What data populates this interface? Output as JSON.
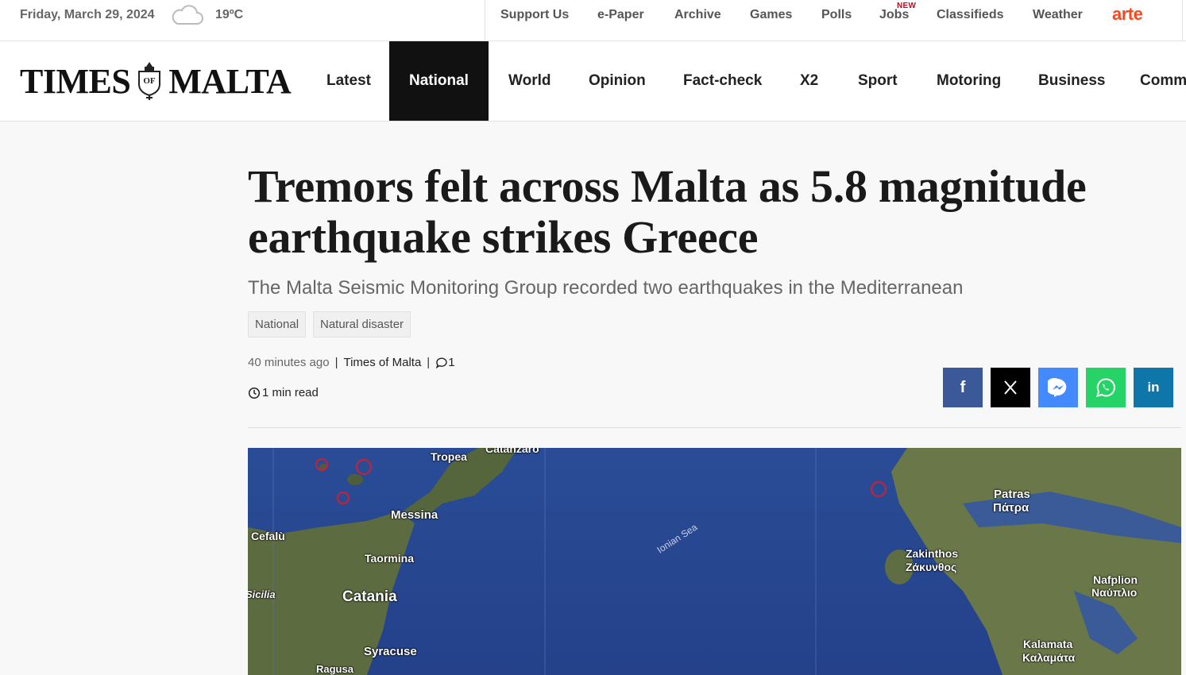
{
  "topbar": {
    "date": "Friday, March 29, 2024",
    "temperature": "19ºC",
    "weather_icon": "cloud-icon",
    "links": [
      "Support Us",
      "e-Paper",
      "Archive",
      "Games",
      "Polls",
      "Jobs",
      "Classifieds",
      "Weather"
    ],
    "jobs_badge": "NEW",
    "partner_logo": "arte"
  },
  "header": {
    "logo_left": "TIMES",
    "logo_crest_text": "OF",
    "logo_right": "MALTA",
    "nav": [
      "Latest",
      "National",
      "World",
      "Opinion",
      "Fact-check",
      "X2",
      "Sport",
      "Motoring",
      "Business",
      "Comm"
    ],
    "active_nav": "National"
  },
  "article": {
    "title_line1": "Tremors felt across Malta as 5.8 magnitude",
    "title_line2": "earthquake strikes Greece",
    "subtitle": "The Malta Seismic Monitoring Group recorded two earthquakes in the Mediterranean",
    "tags": [
      "National",
      "Natural disaster"
    ],
    "published": "40 minutes ago",
    "author": "Times of Malta",
    "comment_count": "1",
    "read_time": "1 min read"
  },
  "share": {
    "buttons": [
      {
        "name": "facebook",
        "icon": "facebook-icon",
        "color": "#3b5998",
        "label": "f"
      },
      {
        "name": "x",
        "icon": "x-icon",
        "color": "#000000",
        "label": "𝕏"
      },
      {
        "name": "messenger",
        "icon": "messenger-icon",
        "color": "#448aff"
      },
      {
        "name": "whatsapp",
        "icon": "whatsapp-icon",
        "color": "#25d366"
      },
      {
        "name": "linkedin",
        "icon": "linkedin-icon",
        "color": "#0e76a8",
        "label": "in"
      }
    ]
  },
  "map": {
    "labels": [
      "Tropea",
      "Catanzaro",
      "Messina",
      "Cefalù",
      "Taormina",
      "Sicilia",
      "Catania",
      "Syracuse",
      "Ragusa",
      "Ionian Sea",
      "Patras",
      "Πάτρα",
      "Zakinthos",
      "Ζάκυνθος",
      "Nafplion",
      "Ναύπλιο",
      "Kalamata",
      "Καλαμάτα"
    ]
  }
}
